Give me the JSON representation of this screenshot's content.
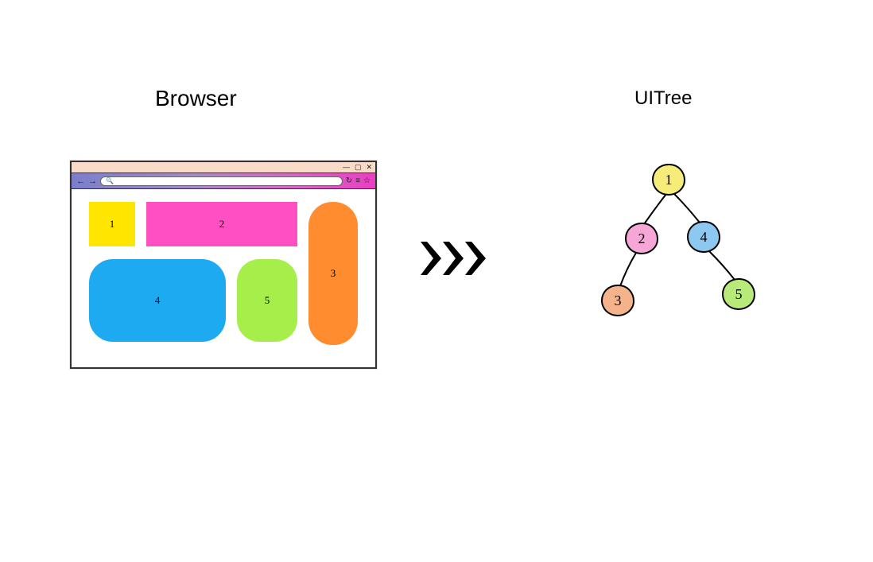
{
  "titles": {
    "browser": "Browser",
    "uitree": "UITree"
  },
  "browser": {
    "boxes": {
      "b1": "1",
      "b2": "2",
      "b3": "3",
      "b4": "4",
      "b5": "5"
    }
  },
  "tree": {
    "nodes": {
      "n1": "1",
      "n2": "2",
      "n3": "3",
      "n4": "4",
      "n5": "5"
    }
  }
}
